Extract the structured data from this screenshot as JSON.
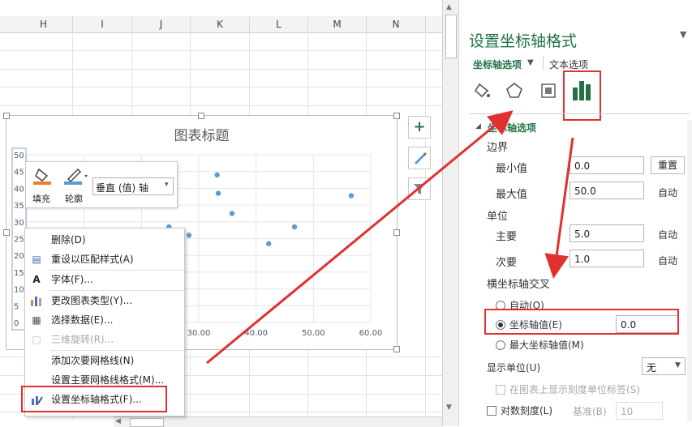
{
  "sheet": {
    "columns": [
      "H",
      "I",
      "J",
      "K",
      "L",
      "M",
      "N"
    ]
  },
  "chart": {
    "title": "图表标题",
    "mini_toolbar": {
      "fill_label": "填充",
      "outline_label": "轮廓",
      "target_select": "垂直 (值) 轴"
    },
    "context_menu": [
      {
        "icon": "delete-icon",
        "label": "删除(D)"
      },
      {
        "icon": "reset-style-icon",
        "label": "重设以匹配样式(A)"
      },
      {
        "icon": "font-icon",
        "label": "字体(F)..."
      },
      {
        "icon": "chart-type-icon",
        "label": "更改图表类型(Y)..."
      },
      {
        "icon": "select-data-icon",
        "label": "选择数据(E)..."
      },
      {
        "icon": "3d-rotate-icon",
        "label": "三维旋转(R)...",
        "disabled": true
      },
      {
        "icon": "",
        "label": "添加次要网格线(N)"
      },
      {
        "icon": "",
        "label": "设置主要网格线格式(M)..."
      },
      {
        "icon": "format-axis-icon",
        "label": "设置坐标轴格式(F)..."
      }
    ],
    "side_buttons": [
      "plus-icon",
      "brush-icon",
      "filter-icon"
    ]
  },
  "chart_data": {
    "type": "scatter",
    "title": "图表标题",
    "y_ticks": [
      "50",
      "45",
      "40",
      "35",
      "30",
      "25",
      "20",
      "15",
      "10",
      "5",
      "0"
    ],
    "x_ticks": [
      "30.00",
      "40.00",
      "50.00",
      "60.00"
    ],
    "x": [
      24.8,
      28.3,
      33.2,
      33.4,
      35.8,
      42.2,
      46.7,
      56.6
    ],
    "y": [
      28.5,
      26.0,
      44.0,
      38.5,
      32.5,
      23.5,
      28.5,
      37.8
    ],
    "xlim": [
      0,
      60
    ],
    "ylim": [
      0,
      50
    ],
    "point_color": "#5b9bd5"
  },
  "panel": {
    "title": "设置坐标轴格式",
    "tab_axis": "坐标轴选项",
    "tab_text": "文本选项",
    "section": "坐标轴选项",
    "bounds_label": "边界",
    "min_label": "最小值",
    "min_value": "0.0",
    "reset_label": "重置",
    "max_label": "最大值",
    "max_value": "50.0",
    "auto_label": "自动",
    "units_label": "单位",
    "major_label": "主要",
    "major_value": "5.0",
    "minor_label": "次要",
    "minor_value": "1.0",
    "cross_label": "横坐标轴交叉",
    "radio_auto": "自动(O)",
    "radio_value": "坐标轴值(E)",
    "cross_value": "0.0",
    "radio_max": "最大坐标轴值(M)",
    "display_units_label": "显示单位(U)",
    "display_units_value": "无",
    "show_units_label": "在图表上显示刻度单位标签(S)",
    "log_label": "对数刻度(L)",
    "base_label": "基准(B)",
    "base_value": "10"
  },
  "colors": {
    "accent_green": "#217346",
    "highlight_red": "#e03030",
    "fill_orange": "#ed7d31",
    "outline_blue": "#5b9bd5"
  }
}
